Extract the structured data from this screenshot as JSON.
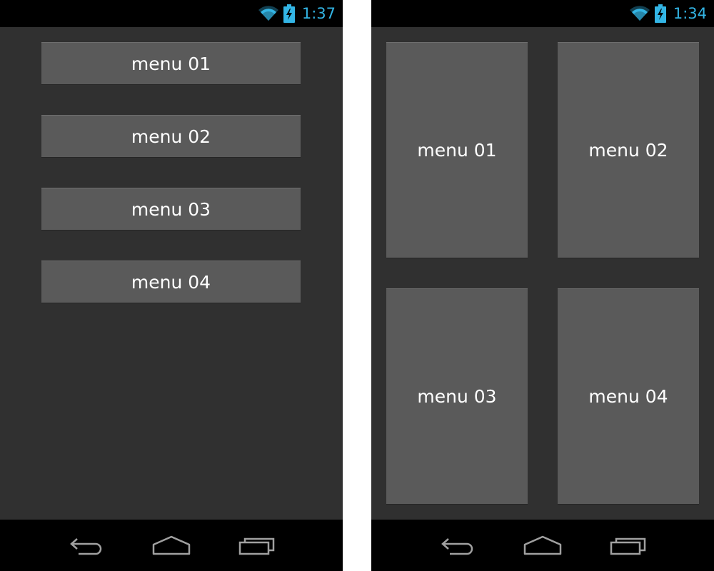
{
  "colors": {
    "accent": "#33b5e5",
    "status_bar_bg": "#000000",
    "screen_bg": "#303030",
    "button_bg": "#5a5a5a",
    "button_text": "#ffffff",
    "nav_icon": "#a0a0a0"
  },
  "screens": [
    {
      "layout": "list",
      "status_bar": {
        "time": "1:37",
        "icons": [
          "wifi-icon",
          "battery-charging-icon"
        ]
      },
      "menu_items": [
        {
          "label": "menu 01"
        },
        {
          "label": "menu 02"
        },
        {
          "label": "menu 03"
        },
        {
          "label": "menu 04"
        }
      ],
      "nav_bar": {
        "icons": [
          "back-icon",
          "home-icon",
          "recent-apps-icon"
        ]
      }
    },
    {
      "layout": "grid",
      "status_bar": {
        "time": "1:34",
        "icons": [
          "wifi-icon",
          "battery-charging-icon"
        ]
      },
      "menu_items": [
        {
          "label": "menu 01"
        },
        {
          "label": "menu 02"
        },
        {
          "label": "menu 03"
        },
        {
          "label": "menu 04"
        }
      ],
      "nav_bar": {
        "icons": [
          "back-icon",
          "home-icon",
          "recent-apps-icon"
        ]
      }
    }
  ]
}
